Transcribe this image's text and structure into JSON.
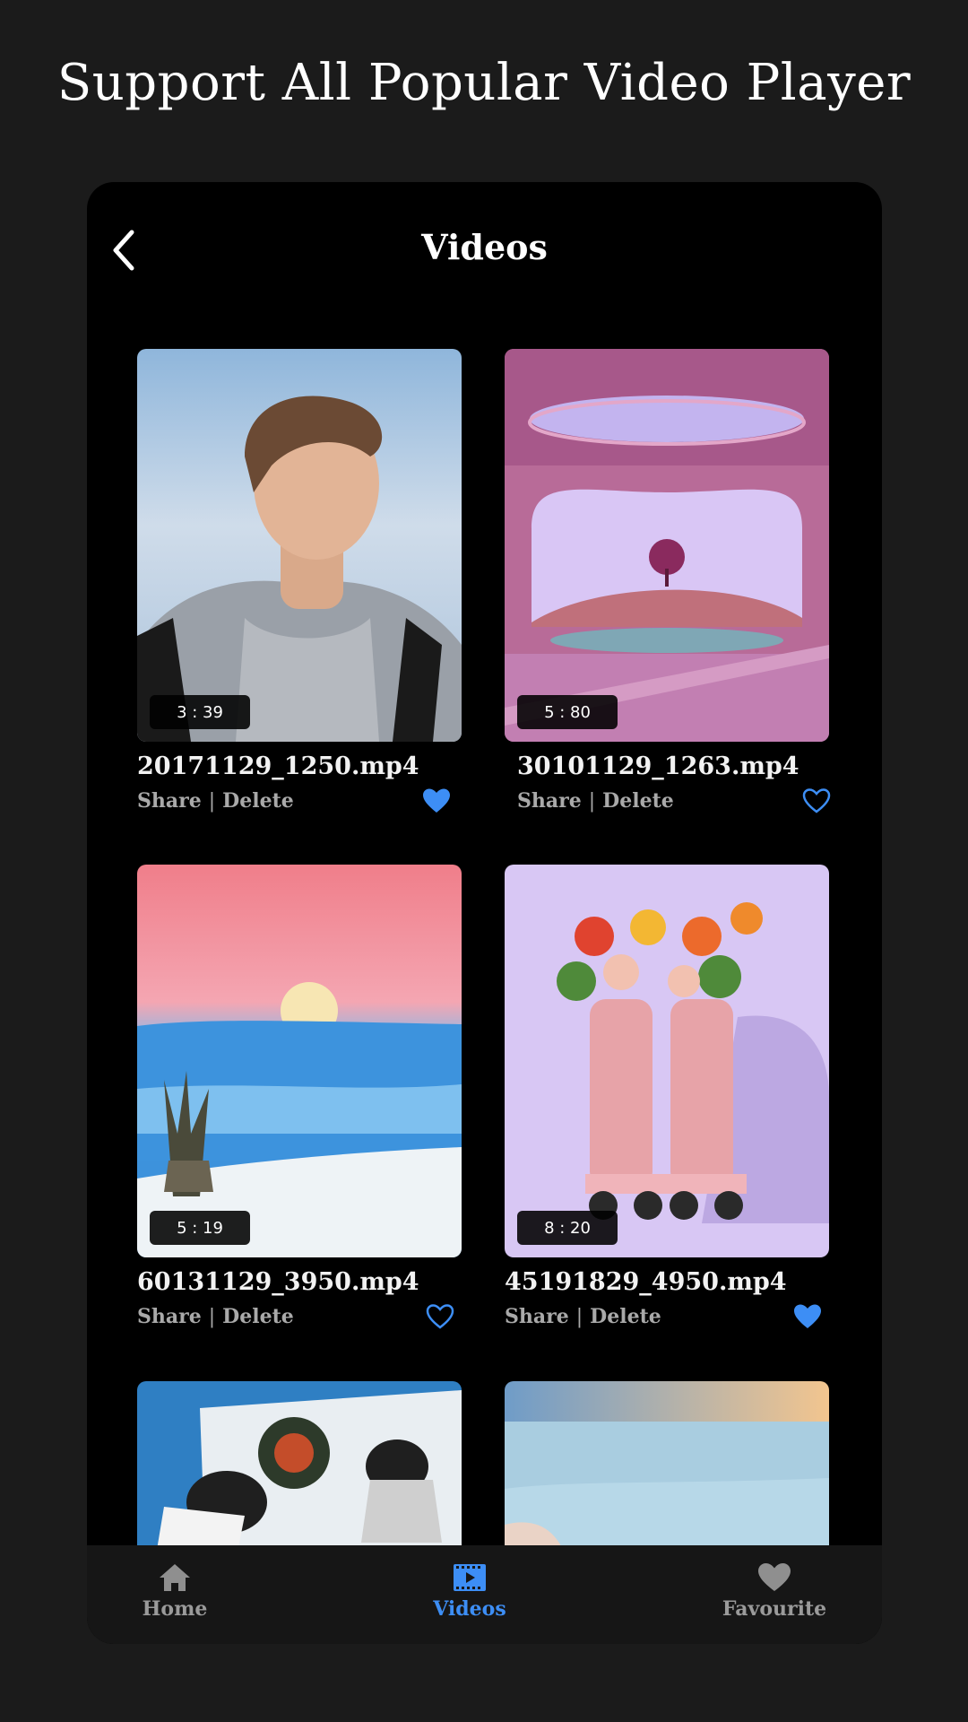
{
  "headline": "Support All Popular Video Player",
  "topbar": {
    "title": "Videos",
    "back_icon": "chevron-left-icon"
  },
  "videos": [
    {
      "filename": "20171129_1250.mp4",
      "duration": "3 : 39",
      "share": "Share",
      "separator": "|",
      "delete": "Delete",
      "favourite": true,
      "thumbnail": "young man in grey hoodie looking up at sky"
    },
    {
      "filename": "30101129_1263.mp4",
      "duration": "5 : 80",
      "share": "Share",
      "separator": "|",
      "delete": "Delete",
      "favourite": false,
      "thumbnail": "pink surreal room with arch window and tree"
    },
    {
      "filename": "60131129_3950.mp4",
      "duration": "5 : 19",
      "share": "Share",
      "separator": "|",
      "delete": "Delete",
      "favourite": false,
      "thumbnail": "full moon over blue mist and yucca in white sand"
    },
    {
      "filename": "45191829_4950.mp4",
      "duration": "8 : 20",
      "share": "Share",
      "separator": "|",
      "delete": "Delete",
      "favourite": true,
      "thumbnail": "pink roller skates with flowers on lavender"
    },
    {
      "thumbnail": "two people hanging a wreath on a wall"
    },
    {
      "thumbnail": "calm sea and beach at sunset"
    }
  ],
  "bottom_nav": [
    {
      "label": "Home",
      "icon": "home-icon",
      "active": false
    },
    {
      "label": "Videos",
      "icon": "video-icon",
      "active": true
    },
    {
      "label": "Favourite",
      "icon": "heart-icon",
      "active": false
    }
  ],
  "colors": {
    "accent": "#3d8ef5",
    "background": "#1b1b1b",
    "panel": "#000000",
    "muted_text": "#a9a9a9"
  }
}
